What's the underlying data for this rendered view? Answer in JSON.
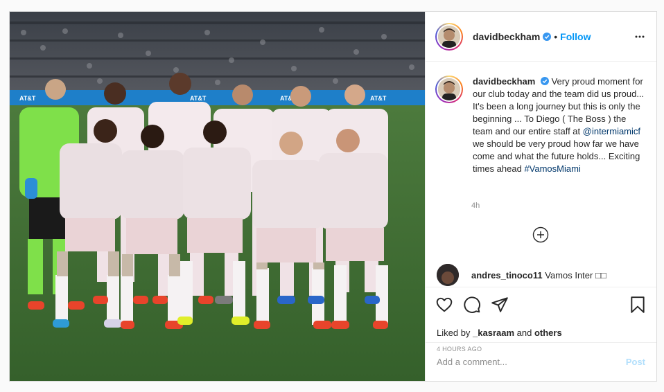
{
  "post": {
    "author": "davidbeckham",
    "follow_label": "Follow",
    "separator": "•",
    "caption_author": "davidbeckham",
    "caption_part1": "Very proud moment for our club today and the team did us proud... It's been a long journey but this is only the beginning ... To Diego ( The Boss ) the team and our entire staff at ",
    "caption_mention": "@intermiamicf",
    "caption_part2": " we should be very proud how far we have come and what the future holds... Exciting times ahead ",
    "caption_hashtag": "#VamosMiami",
    "caption_time": "4h",
    "comment": {
      "author": "andres_tinoco11",
      "text": "Vamos Inter □□"
    },
    "liked_by_prefix": "Liked by ",
    "liked_by_user": "_kasraam",
    "liked_by_mid": " and ",
    "liked_by_others": "others",
    "time_ago": "4 HOURS AGO",
    "comment_placeholder": "Add a comment...",
    "post_label": "Post"
  },
  "colors": {
    "accent": "#0095f6",
    "post_disabled": "#b2dffc",
    "text": "#262626",
    "muted": "#8e8e8e"
  },
  "icons": [
    "verified-badge-icon",
    "more-options-icon",
    "heart-icon",
    "comment-icon",
    "share-icon",
    "bookmark-icon",
    "load-more-plus-icon"
  ]
}
